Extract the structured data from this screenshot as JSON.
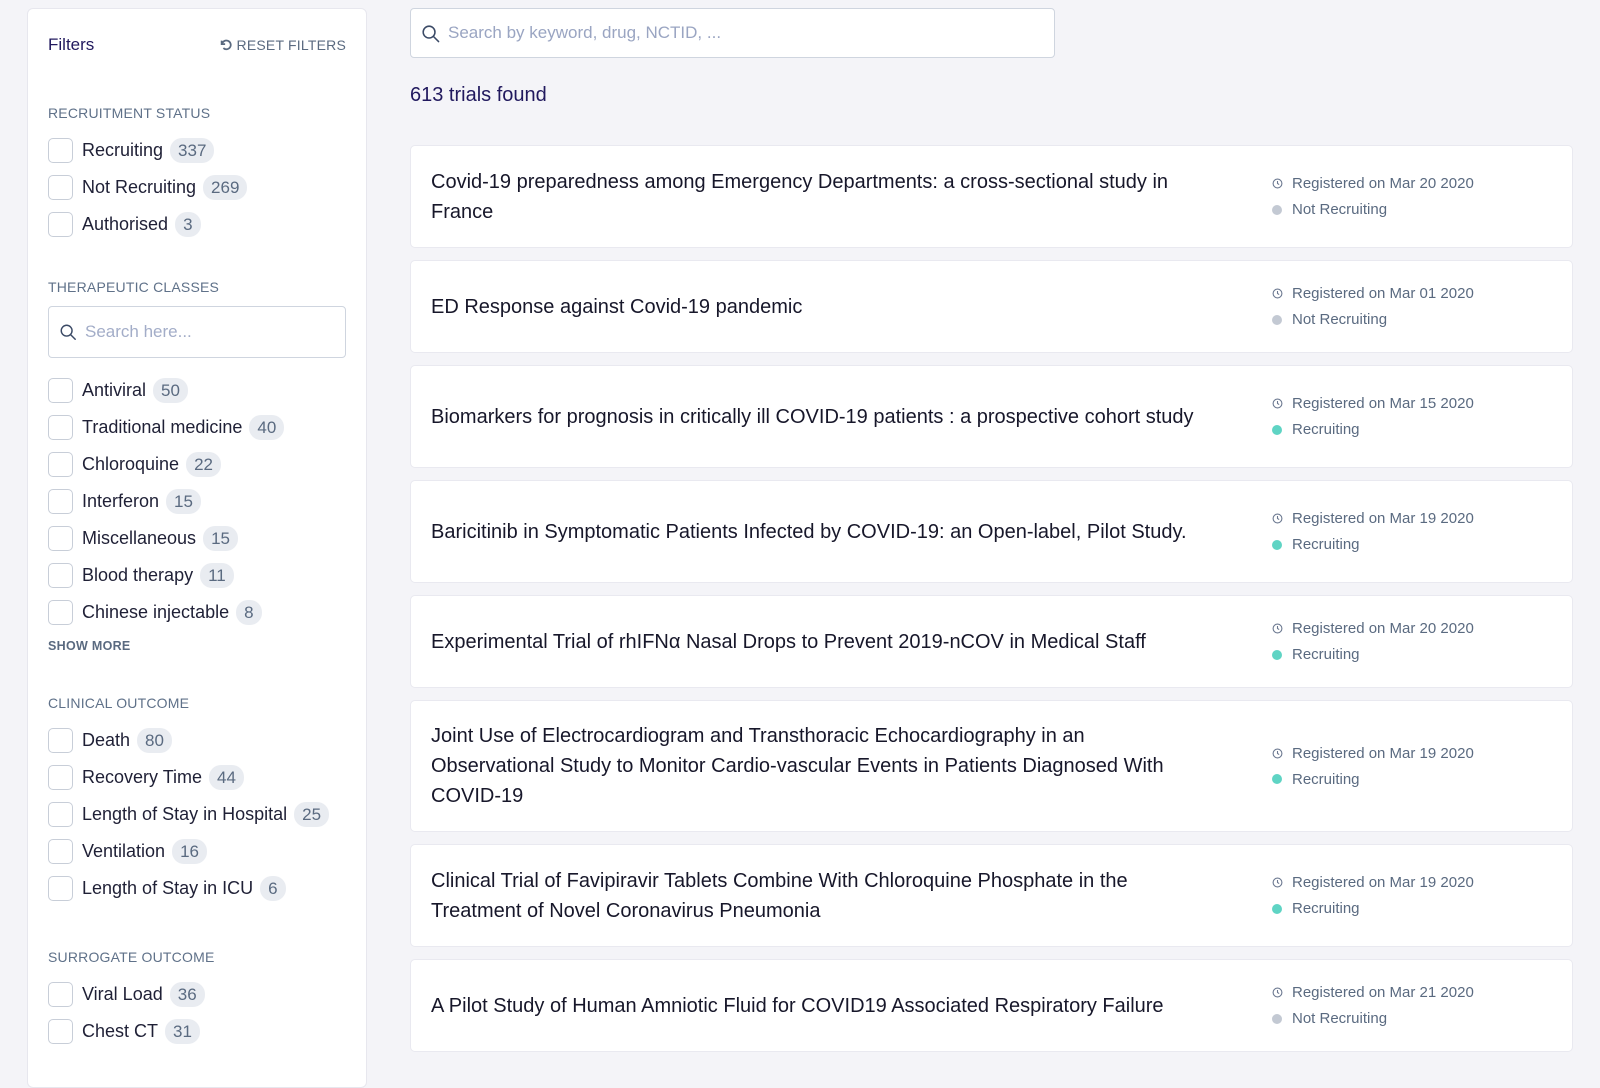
{
  "sidebar": {
    "title": "Filters",
    "reset_label": "RESET FILTERS",
    "sections": {
      "recruitment": {
        "title": "RECRUITMENT STATUS",
        "options": [
          {
            "label": "Recruiting",
            "count": "337"
          },
          {
            "label": "Not Recruiting",
            "count": "269"
          },
          {
            "label": "Authorised",
            "count": "3"
          }
        ]
      },
      "therapeutic": {
        "title": "THERAPEUTIC CLASSES",
        "search_placeholder": "Search here...",
        "options": [
          {
            "label": "Antiviral",
            "count": "50"
          },
          {
            "label": "Traditional medicine",
            "count": "40"
          },
          {
            "label": "Chloroquine",
            "count": "22"
          },
          {
            "label": "Interferon",
            "count": "15"
          },
          {
            "label": "Miscellaneous",
            "count": "15"
          },
          {
            "label": "Blood therapy",
            "count": "11"
          },
          {
            "label": "Chinese injectable",
            "count": "8"
          }
        ],
        "show_more_label": "SHOW MORE"
      },
      "clinical": {
        "title": "CLINICAL OUTCOME",
        "options": [
          {
            "label": "Death",
            "count": "80"
          },
          {
            "label": "Recovery Time",
            "count": "44"
          },
          {
            "label": "Length of Stay in Hospital",
            "count": "25"
          },
          {
            "label": "Ventilation",
            "count": "16"
          },
          {
            "label": "Length of Stay in ICU",
            "count": "6"
          }
        ]
      },
      "surrogate": {
        "title": "SURROGATE OUTCOME",
        "options": [
          {
            "label": "Viral Load",
            "count": "36"
          },
          {
            "label": "Chest CT",
            "count": "31"
          }
        ]
      }
    }
  },
  "search": {
    "placeholder": "Search by keyword, drug, NCTID, ...",
    "value": ""
  },
  "results": {
    "count_label": "613 trials found",
    "status_colors": {
      "Recruiting": "#5fd4c4",
      "Not Recruiting": "#c3c9d3"
    },
    "trials": [
      {
        "title": "Covid-19 preparedness among Emergency Departments: a cross-sectional study in France",
        "registered": "Registered on Mar 20 2020",
        "status": "Not Recruiting"
      },
      {
        "title": "ED Response against Covid-19 pandemic",
        "registered": "Registered on Mar 01 2020",
        "status": "Not Recruiting"
      },
      {
        "title": "Biomarkers for prognosis in critically ill COVID-19 patients : a prospective cohort study",
        "registered": "Registered on Mar 15 2020",
        "status": "Recruiting"
      },
      {
        "title": "Baricitinib in Symptomatic Patients Infected by COVID-19: an Open-label, Pilot Study.",
        "registered": "Registered on Mar 19 2020",
        "status": "Recruiting"
      },
      {
        "title": "Experimental Trial of rhIFNα Nasal Drops to Prevent 2019-nCOV in Medical Staff",
        "registered": "Registered on Mar 20 2020",
        "status": "Recruiting"
      },
      {
        "title": "Joint Use of Electrocardiogram and Transthoracic Echocardiography in an Observational Study to Monitor Cardio-vascular Events in Patients Diagnosed With COVID-19",
        "registered": "Registered on Mar 19 2020",
        "status": "Recruiting"
      },
      {
        "title": "Clinical Trial of Favipiravir Tablets Combine With Chloroquine Phosphate in the Treatment of Novel Coronavirus Pneumonia",
        "registered": "Registered on Mar 19 2020",
        "status": "Recruiting"
      },
      {
        "title": "A Pilot Study of Human Amniotic Fluid for COVID19 Associated Respiratory Failure",
        "registered": "Registered on Mar 21 2020",
        "status": "Not Recruiting"
      }
    ]
  }
}
